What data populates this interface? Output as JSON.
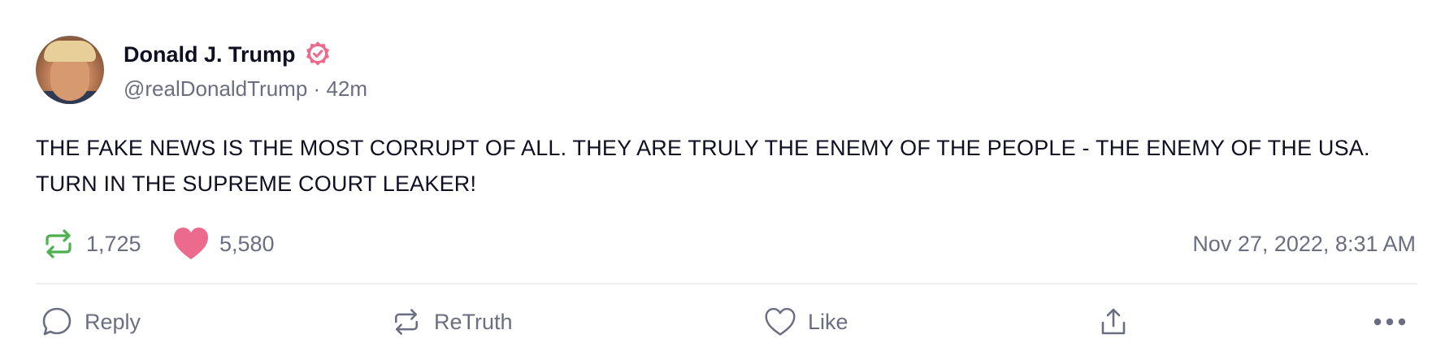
{
  "post": {
    "author_name": "Donald J. Trump",
    "handle": "@realDonaldTrump",
    "separator": "·",
    "age": "42m",
    "text": "THE FAKE NEWS IS THE MOST CORRUPT OF ALL. THEY ARE TRULY THE ENEMY OF THE PEOPLE - THE ENEMY OF THE USA. TURN IN THE SUPREME COURT LEAKER!",
    "timestamp": "Nov 27, 2022, 8:31 AM"
  },
  "stats": {
    "retruths": "1,725",
    "likes": "5,580"
  },
  "actions": {
    "reply_label": "Reply",
    "retruth_label": "ReTruth",
    "like_label": "Like"
  },
  "icons": {
    "verified": "verified-badge-icon",
    "retruth": "retruth-icon",
    "heart": "heart-icon",
    "reply": "reply-bubble-icon",
    "share": "share-upload-icon",
    "more": "more-dots-icon"
  },
  "colors": {
    "accent_pink": "#ec6a8b",
    "retruth_green": "#4caf50",
    "text_primary": "#0f0f23",
    "text_secondary": "#6b6e80"
  }
}
